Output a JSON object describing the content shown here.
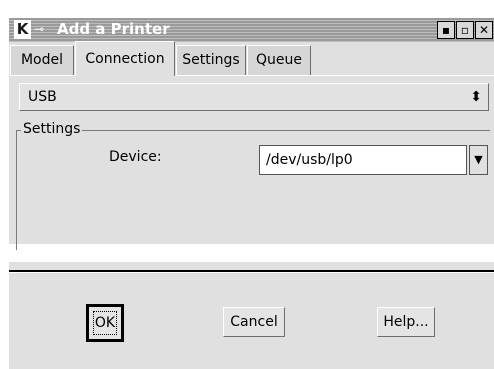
{
  "window": {
    "title": "Add a Printer",
    "app_icon": "K",
    "pin_icon": "pin-icon",
    "controls": {
      "minimize": "▪",
      "maximize": "▫",
      "close": "✕"
    }
  },
  "tabs": [
    {
      "label": "Model",
      "active": false
    },
    {
      "label": "Connection",
      "active": true
    },
    {
      "label": "Settings",
      "active": false
    },
    {
      "label": "Queue",
      "active": false
    }
  ],
  "connection": {
    "type_value": "USB",
    "arrow": "⬍"
  },
  "settings": {
    "group_label": "Settings",
    "device_label": "Device:",
    "device_value": "/dev/usb/lp0",
    "combo_arrow": "▼"
  },
  "buttons": {
    "ok": "OK",
    "cancel": "Cancel",
    "help": "Help..."
  },
  "colors": {
    "titlebar": "#9a9a9a",
    "panel": "#e0e0e0"
  }
}
